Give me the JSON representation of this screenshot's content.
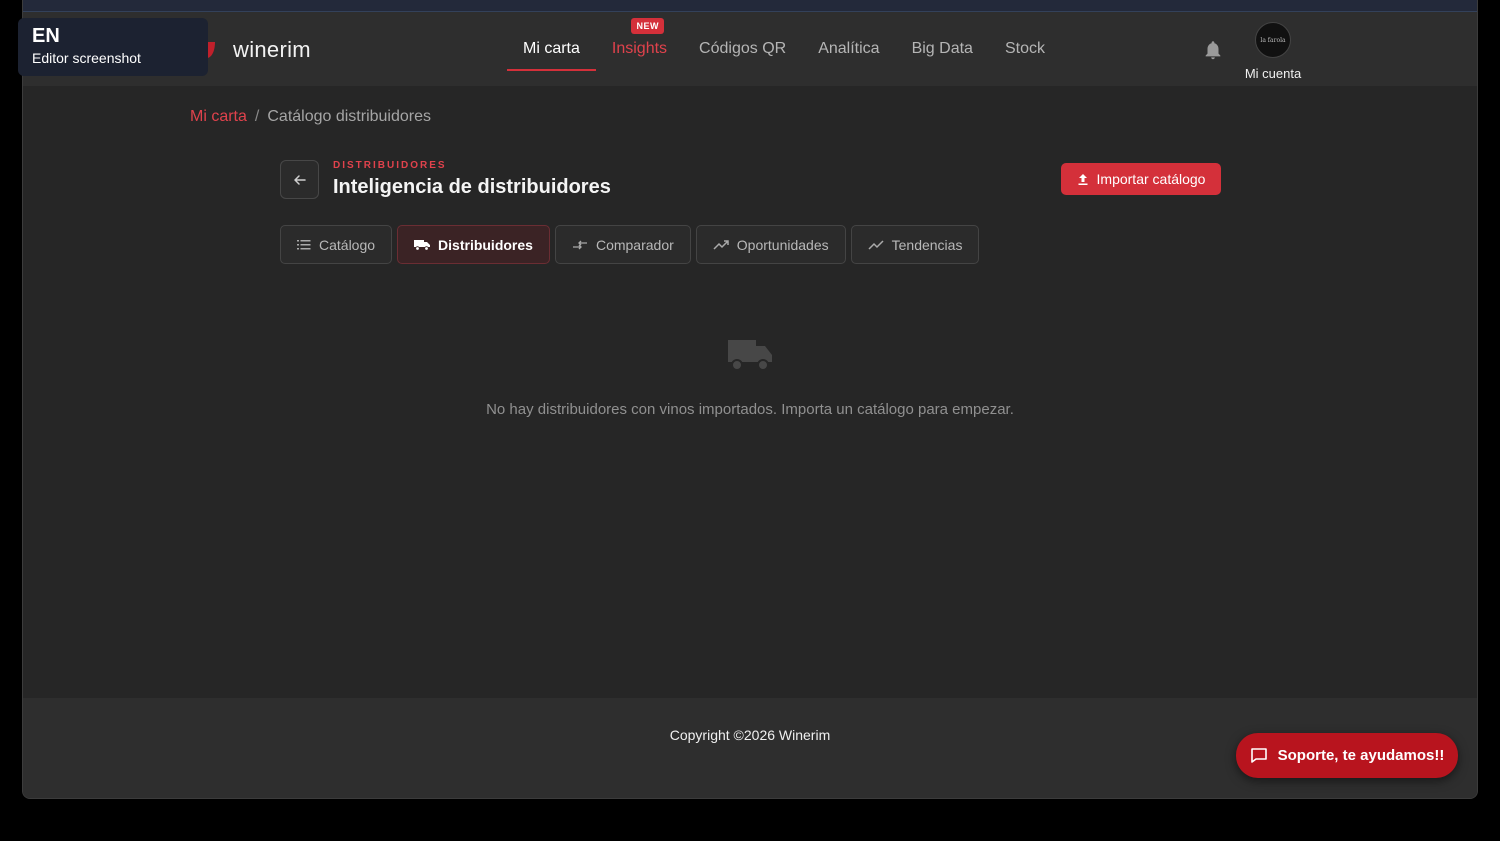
{
  "lang_tooltip": {
    "code": "EN",
    "subtitle": "Editor screenshot"
  },
  "brand": {
    "name": "winerim"
  },
  "nav": {
    "items": [
      {
        "label": "Mi carta"
      },
      {
        "label": "Insights",
        "badge": "NEW"
      },
      {
        "label": "Códigos QR"
      },
      {
        "label": "Analítica"
      },
      {
        "label": "Big Data"
      },
      {
        "label": "Stock"
      }
    ],
    "active": "Mi carta"
  },
  "account": {
    "label": "Mi cuenta",
    "avatar_text": "la farola"
  },
  "breadcrumb": {
    "root": "Mi carta",
    "separator": "/",
    "current": "Catálogo distribuidores"
  },
  "header": {
    "kicker": "DISTRIBUIDORES",
    "title": "Inteligencia de distribuidores",
    "import_label": "Importar catálogo"
  },
  "tabs": [
    {
      "label": "Catálogo",
      "icon": "list-icon"
    },
    {
      "label": "Distribuidores",
      "icon": "truck-icon",
      "active": true
    },
    {
      "label": "Comparador",
      "icon": "compare-arrows-icon"
    },
    {
      "label": "Oportunidades",
      "icon": "trending-up-icon"
    },
    {
      "label": "Tendencias",
      "icon": "trend-line-icon"
    }
  ],
  "empty_state": {
    "icon": "truck-icon",
    "message": "No hay distribuidores con vinos importados. Importa un catálogo para empezar."
  },
  "footer": {
    "copyright": "Copyright ©2026 Winerim"
  },
  "support": {
    "label": "Soporte, te ayudamos!!"
  },
  "colors": {
    "accent": "#d4303a",
    "background": "#262626",
    "navbar": "#2e2e2e",
    "support": "#b8141e",
    "strips": [
      "#c34fa8",
      "#e0585f",
      "#3fa56a",
      "#3b8bd6"
    ]
  }
}
